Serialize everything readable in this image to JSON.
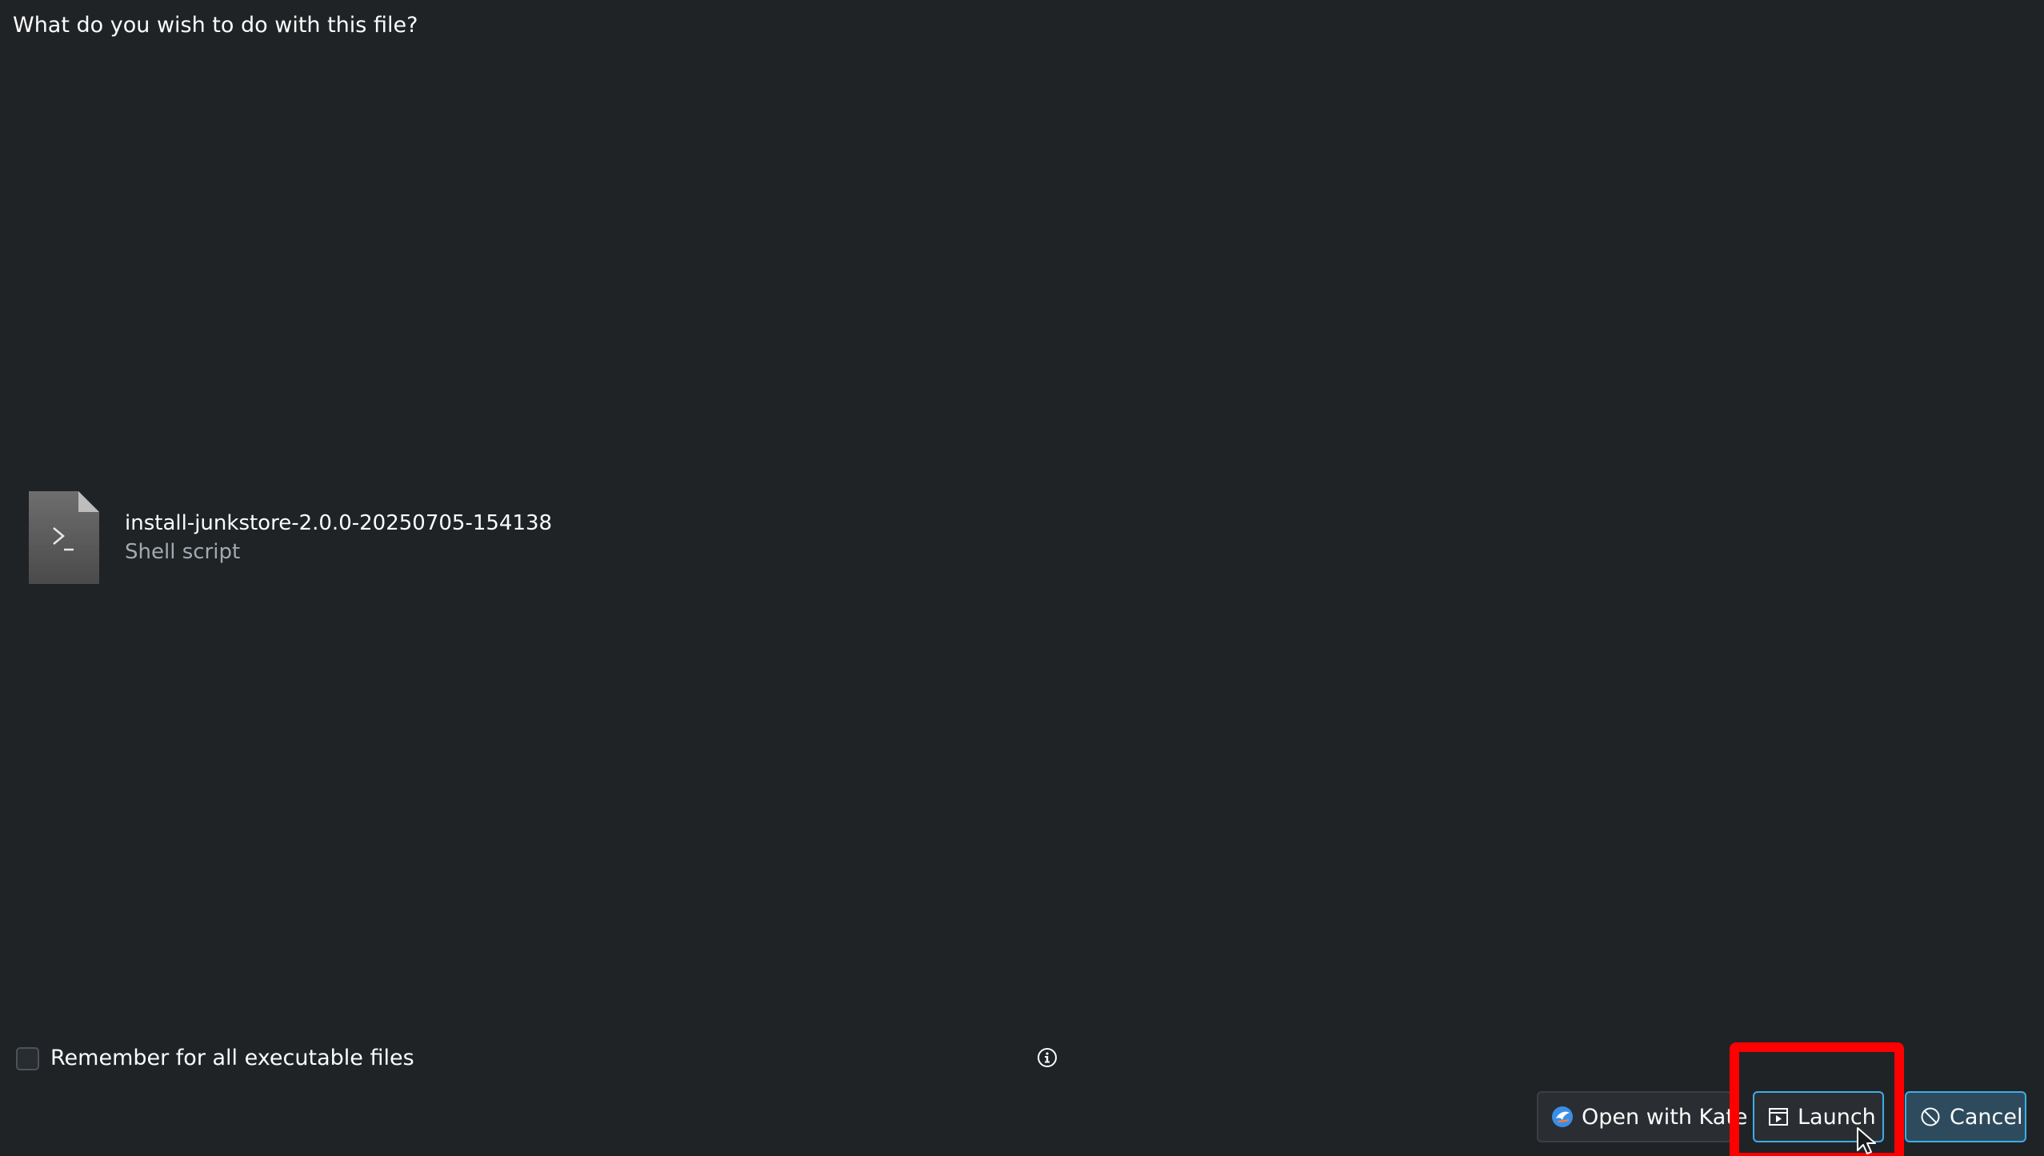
{
  "dialog": {
    "question": "What do you wish to do with this file?"
  },
  "file": {
    "name": "install-junkstore-2.0.0-20250705-154138",
    "type": "Shell script",
    "icon": "shell-script-file-icon"
  },
  "remember": {
    "label": "Remember for all executable files",
    "checked": false
  },
  "buttons": {
    "open_with_kate": "Open with Kate",
    "launch": "Launch",
    "cancel": "Cancel"
  },
  "colors": {
    "background": "#202326",
    "accent": "#3daee9",
    "highlight": "#ff0000",
    "text": "#fcfcfc",
    "secondary_text": "#a1a9b1"
  }
}
